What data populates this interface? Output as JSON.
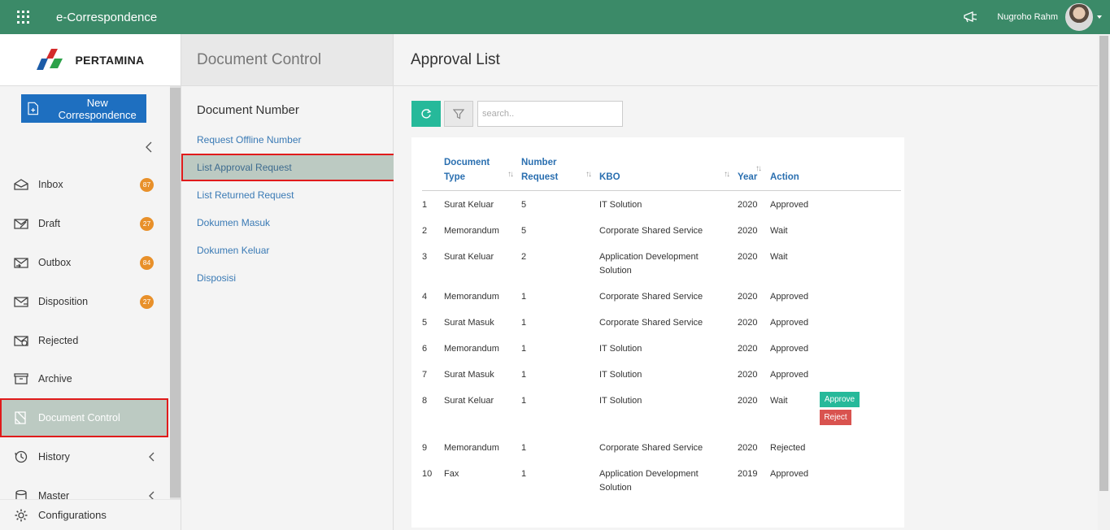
{
  "topbar": {
    "app_title": "e-Correspondence",
    "user_name": "Nugroho Rahm",
    "colors": {
      "bar": "#3b8a68"
    }
  },
  "sidebar": {
    "logo_text": "PERTAMINA",
    "new_button": "New Correspondence",
    "items": [
      {
        "label": "Inbox",
        "icon": "inbox-icon",
        "badge": "87"
      },
      {
        "label": "Draft",
        "icon": "draft-icon",
        "badge": "27"
      },
      {
        "label": "Outbox",
        "icon": "outbox-icon",
        "badge": "84"
      },
      {
        "label": "Disposition",
        "icon": "disposition-icon",
        "badge": "27"
      },
      {
        "label": "Rejected",
        "icon": "rejected-icon"
      },
      {
        "label": "Archive",
        "icon": "archive-icon"
      },
      {
        "label": "Document Control",
        "icon": "document-control-icon",
        "active": true
      },
      {
        "label": "History",
        "icon": "history-icon"
      },
      {
        "label": "Master",
        "icon": "master-icon"
      }
    ],
    "configurations": "Configurations"
  },
  "midpanel": {
    "title": "Document Control",
    "section": "Document Number",
    "links": [
      {
        "label": "Request Offline Number"
      },
      {
        "label": "List Approval Request",
        "active": true
      },
      {
        "label": "List Returned Request"
      },
      {
        "label": "Dokumen Masuk"
      },
      {
        "label": "Dokumen Keluar"
      },
      {
        "label": "Disposisi"
      }
    ]
  },
  "main": {
    "title": "Approval List",
    "search_placeholder": "search..",
    "columns": {
      "doc_type_1": "Document",
      "doc_type_2": "Type",
      "num_req_1": "Number",
      "num_req_2": "Request",
      "kbo": "KBO",
      "year": "Year",
      "action": "Action"
    },
    "rows": [
      {
        "no": "1",
        "type": "Surat Keluar",
        "num": "5",
        "kbo": "IT Solution",
        "year": "2020",
        "status": "Approved"
      },
      {
        "no": "2",
        "type": "Memorandum",
        "num": "5",
        "kbo": "Corporate Shared Service",
        "year": "2020",
        "status": "Wait"
      },
      {
        "no": "3",
        "type": "Surat Keluar",
        "num": "2",
        "kbo": "Application Development Solution",
        "year": "2020",
        "status": "Wait"
      },
      {
        "no": "4",
        "type": "Memorandum",
        "num": "1",
        "kbo": "Corporate Shared Service",
        "year": "2020",
        "status": "Approved"
      },
      {
        "no": "5",
        "type": "Surat Masuk",
        "num": "1",
        "kbo": "Corporate Shared Service",
        "year": "2020",
        "status": "Approved"
      },
      {
        "no": "6",
        "type": "Memorandum",
        "num": "1",
        "kbo": "IT Solution",
        "year": "2020",
        "status": "Approved"
      },
      {
        "no": "7",
        "type": "Surat Masuk",
        "num": "1",
        "kbo": "IT Solution",
        "year": "2020",
        "status": "Approved"
      },
      {
        "no": "8",
        "type": "Surat Keluar",
        "num": "1",
        "kbo": "IT Solution",
        "year": "2020",
        "status": "Wait",
        "approve": "Approve",
        "reject": "Reject"
      },
      {
        "no": "9",
        "type": "Memorandum",
        "num": "1",
        "kbo": "Corporate Shared Service",
        "year": "2020",
        "status": "Rejected"
      },
      {
        "no": "10",
        "type": "Fax",
        "num": "1",
        "kbo": "Application Development Solution",
        "year": "2019",
        "status": "Approved"
      }
    ]
  }
}
